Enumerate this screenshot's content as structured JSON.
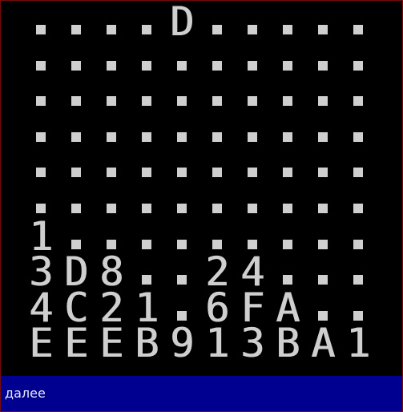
{
  "board": {
    "rows": [
      [
        ".",
        ".",
        ".",
        ".",
        "D",
        ".",
        ".",
        ".",
        ".",
        "."
      ],
      [
        ".",
        ".",
        ".",
        ".",
        ".",
        ".",
        ".",
        ".",
        ".",
        "."
      ],
      [
        ".",
        ".",
        ".",
        ".",
        ".",
        ".",
        ".",
        ".",
        ".",
        "."
      ],
      [
        ".",
        ".",
        ".",
        ".",
        ".",
        ".",
        ".",
        ".",
        ".",
        "."
      ],
      [
        ".",
        ".",
        ".",
        ".",
        ".",
        ".",
        ".",
        ".",
        ".",
        "."
      ],
      [
        ".",
        ".",
        ".",
        ".",
        ".",
        ".",
        ".",
        ".",
        ".",
        "."
      ],
      [
        "1",
        ".",
        ".",
        ".",
        ".",
        ".",
        ".",
        ".",
        ".",
        "."
      ],
      [
        "3",
        "D",
        "8",
        ".",
        ".",
        "2",
        "4",
        ".",
        ".",
        "."
      ],
      [
        "4",
        "C",
        "2",
        "1",
        ".",
        "6",
        "F",
        "A",
        ".",
        "."
      ],
      [
        "E",
        "E",
        "E",
        "B",
        "9",
        "1",
        "3",
        "B",
        "A",
        "1"
      ]
    ]
  },
  "status": {
    "label": "далее"
  },
  "colors": {
    "background": "#000000",
    "tile_text": "#cfcfcf",
    "status_bar": "#000090",
    "status_text": "#e8e8ff",
    "frame_border": "#7a0a0a"
  }
}
